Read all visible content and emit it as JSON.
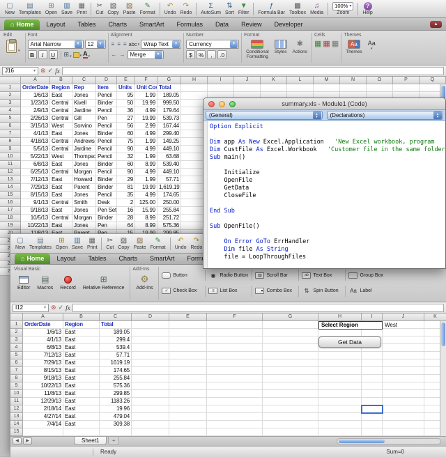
{
  "misc": {
    "fx": "fx"
  },
  "colors": {
    "accent_green": "#5a9732",
    "selection_blue": "#3b6fd4",
    "header_text_blue": "#2230c0",
    "vba_keyword_blue": "#0018c8",
    "vba_comment_green": "#0a7a0a",
    "record_red": "#c81e14",
    "aqua_scrollbar": "#6694d8"
  },
  "toolbar": {
    "groups": [
      [
        {
          "name": "new",
          "label": "New",
          "glyph": "▢",
          "color": "#5a7a9a"
        },
        {
          "name": "templates",
          "label": "Templates",
          "glyph": "▤",
          "color": "#5a7a9a"
        },
        {
          "name": "open",
          "label": "Open",
          "glyph": "⊞",
          "color": "#9a7b3c"
        },
        {
          "name": "save",
          "label": "Save",
          "glyph": "▥",
          "color": "#3c6a9a"
        },
        {
          "name": "print",
          "label": "Print",
          "glyph": "▦",
          "color": "#666666"
        }
      ],
      [
        {
          "name": "cut",
          "label": "Cut",
          "glyph": "✂",
          "color": "#555555"
        },
        {
          "name": "copy",
          "label": "Copy",
          "glyph": "▧",
          "color": "#555555"
        },
        {
          "name": "paste",
          "label": "Paste",
          "glyph": "▨",
          "color": "#8a6a3c"
        },
        {
          "name": "format",
          "label": "Format",
          "glyph": "✎",
          "color": "#3c8a3c"
        }
      ],
      [
        {
          "name": "undo",
          "label": "Undo",
          "glyph": "↶",
          "color": "#b8860b"
        },
        {
          "name": "redo",
          "label": "Redo",
          "glyph": "↷",
          "color": "#b8860b"
        }
      ],
      [
        {
          "name": "autosum",
          "label": "AutoSum",
          "glyph": "Σ",
          "color": "#2f5f8f"
        },
        {
          "name": "sort",
          "label": "Sort",
          "glyph": "⇅",
          "color": "#2f5f8f"
        },
        {
          "name": "filter",
          "label": "Filter",
          "glyph": "▼",
          "color": "#3c8a3c"
        }
      ],
      [
        {
          "name": "formula-bar",
          "label": "Formula Bar",
          "glyph": "ƒ",
          "color": "#2f5f8f"
        },
        {
          "name": "toolbox",
          "label": "Toolbox",
          "glyph": "▩",
          "color": "#555555"
        },
        {
          "name": "media",
          "label": "Media",
          "glyph": "♫",
          "color": "#7a3c8a"
        }
      ]
    ],
    "zoom": {
      "label": "Zoom",
      "value": "100%"
    },
    "help": {
      "label": "Help",
      "glyph": "?"
    }
  },
  "ribbon_tabs": [
    {
      "label": "Home",
      "active": true
    },
    {
      "label": "Layout"
    },
    {
      "label": "Tables"
    },
    {
      "label": "Charts"
    },
    {
      "label": "SmartArt"
    },
    {
      "label": "Formulas"
    },
    {
      "label": "Data"
    },
    {
      "label": "Review"
    },
    {
      "label": "Developer"
    }
  ],
  "ribbon1": {
    "group_edit": "Edit",
    "group_font": "Font",
    "group_alignment": "Alignment",
    "group_number": "Number",
    "group_format": "Format",
    "group_cells": "Cells",
    "group_themes": "Themes",
    "font_name": "Arial Narrow",
    "font_size": "12",
    "bold": "B",
    "italic": "I",
    "underline": "U",
    "abc": "abc",
    "wrap_text": "Wrap Text",
    "merge": "Merge",
    "number_format": "Currency",
    "cond_line1": "Conditional",
    "cond_line2": "Formatting",
    "styles": "Styles",
    "actions": "Actions",
    "themes_label": "Themes",
    "fonts_aa": "Aa"
  },
  "ribbon2": {
    "group_visual_basic": "Visual Basic",
    "group_addins": "Add-Ins",
    "items": [
      {
        "name": "editor",
        "label": "Editor"
      },
      {
        "name": "macros",
        "label": "Macros"
      },
      {
        "name": "record",
        "label": "Record"
      },
      {
        "name": "relative-reference",
        "label": "Relative Reference"
      }
    ],
    "addins_label": "Add-Ins",
    "form_controls": {
      "row1": [
        {
          "name": "button",
          "label": "Button"
        },
        {
          "name": "radio-button",
          "label": "Radio Button"
        },
        {
          "name": "scroll-bar",
          "label": "Scroll Bar"
        },
        {
          "name": "text-box",
          "label": "Text Box"
        },
        {
          "name": "group-box",
          "label": "Group Box"
        }
      ],
      "row2": [
        {
          "name": "check-box",
          "label": "Check Box"
        },
        {
          "name": "list-box",
          "label": "List Box"
        },
        {
          "name": "combo-box",
          "label": "Combo Box"
        },
        {
          "name": "spin-button",
          "label": "Spin Button"
        },
        {
          "name": "label",
          "label": "Label"
        }
      ]
    }
  },
  "sheet1": {
    "name_box": "J16",
    "col_letters": [
      "A",
      "B",
      "C",
      "D",
      "E",
      "F",
      "G",
      "H",
      "I",
      "J",
      "K",
      "L",
      "M",
      "N",
      "O",
      "P",
      "Q"
    ],
    "header_row": [
      "OrderDate",
      "Region",
      "Rep",
      "Item",
      "Units",
      "Unit Cost",
      "Total"
    ],
    "rows": [
      [
        "1/6/13",
        "East",
        "Jones",
        "Pencil",
        "95",
        "1.99",
        "189.05"
      ],
      [
        "1/23/13",
        "Central",
        "Kivell",
        "Binder",
        "50",
        "19.99",
        "999.50"
      ],
      [
        "2/9/13",
        "Central",
        "Jardine",
        "Pencil",
        "36",
        "4.99",
        "179.64"
      ],
      [
        "2/26/13",
        "Central",
        "Gill",
        "Pen",
        "27",
        "19.99",
        "539.73"
      ],
      [
        "3/15/13",
        "West",
        "Sorvino",
        "Pencil",
        "56",
        "2.99",
        "167.44"
      ],
      [
        "4/1/13",
        "East",
        "Jones",
        "Binder",
        "60",
        "4.99",
        "299.40"
      ],
      [
        "4/18/13",
        "Central",
        "Andrews",
        "Pencil",
        "75",
        "1.99",
        "149.25"
      ],
      [
        "5/5/13",
        "Central",
        "Jardine",
        "Pencil",
        "90",
        "4.99",
        "449.10"
      ],
      [
        "5/22/13",
        "West",
        "Thompson",
        "Pencil",
        "32",
        "1.99",
        "63.68"
      ],
      [
        "6/8/13",
        "East",
        "Jones",
        "Binder",
        "60",
        "8.99",
        "539.40"
      ],
      [
        "6/25/13",
        "Central",
        "Morgan",
        "Pencil",
        "90",
        "4.99",
        "449.10"
      ],
      [
        "7/12/13",
        "East",
        "Howard",
        "Binder",
        "29",
        "1.99",
        "57.71"
      ],
      [
        "7/29/13",
        "East",
        "Parent",
        "Binder",
        "81",
        "19.99",
        "1,619.19"
      ],
      [
        "8/15/13",
        "East",
        "Jones",
        "Pencil",
        "35",
        "4.99",
        "174.65"
      ],
      [
        "9/1/13",
        "Central",
        "Smith",
        "Desk",
        "2",
        "125.00",
        "250.00"
      ],
      [
        "9/18/13",
        "East",
        "Jones",
        "Pen Set",
        "16",
        "15.99",
        "255.84"
      ],
      [
        "10/5/13",
        "Central",
        "Morgan",
        "Binder",
        "28",
        "8.99",
        "251.72"
      ],
      [
        "10/22/13",
        "East",
        "Jones",
        "Pen",
        "64",
        "8.99",
        "575.36"
      ],
      [
        "11/8/13",
        "East",
        "Parent",
        "Pen",
        "15",
        "19.99",
        "299.85"
      ]
    ]
  },
  "sheet2": {
    "name_box": "I12",
    "col_letters": [
      "A",
      "B",
      "C",
      "D",
      "E",
      "F",
      "G",
      "H",
      "I",
      "J",
      "K"
    ],
    "header_row": [
      "OrderDate",
      "Region",
      "Total"
    ],
    "rows": [
      [
        "1/6/13",
        "East",
        "189.05"
      ],
      [
        "4/1/13",
        "East",
        "299.4"
      ],
      [
        "6/8/13",
        "East",
        "539.4"
      ],
      [
        "7/12/13",
        "East",
        "57.71"
      ],
      [
        "7/29/13",
        "East",
        "1619.19"
      ],
      [
        "8/15/13",
        "East",
        "174.65"
      ],
      [
        "9/18/13",
        "East",
        "255.84"
      ],
      [
        "10/22/13",
        "East",
        "575.36"
      ],
      [
        "11/8/13",
        "East",
        "299.85"
      ],
      [
        "12/29/13",
        "East",
        "1183.26"
      ],
      [
        "2/18/14",
        "East",
        "19.96"
      ],
      [
        "4/27/14",
        "East",
        "479.04"
      ],
      [
        "7/4/14",
        "East",
        "309.38"
      ]
    ],
    "select_region_label": "Select Region",
    "region_value": "West",
    "get_data_button": "Get Data",
    "sheet_tab": "Sheet1",
    "new_sheet_tab": "+",
    "status_ready": "Ready",
    "status_sum": "Sum=0"
  },
  "vba": {
    "window_title": "summary.xls - Module1 (Code)",
    "left_dropdown": "(General)",
    "right_dropdown": "(Declarations)",
    "code_lines": [
      [
        [
          "Option Explicit",
          "k"
        ]
      ],
      [],
      [
        [
          "Dim",
          "k"
        ],
        [
          " app ",
          "n"
        ],
        [
          "As",
          "k"
        ],
        [
          " ",
          "n"
        ],
        [
          "New",
          "k"
        ],
        [
          " Excel.Application   ",
          "n"
        ],
        [
          "'New Excel workbook, program",
          "c"
        ]
      ],
      [
        [
          "Dim",
          "k"
        ],
        [
          " CustFile ",
          "n"
        ],
        [
          "As",
          "k"
        ],
        [
          " Excel.Workbook   ",
          "n"
        ],
        [
          "'Customer file in the same folder",
          "c"
        ]
      ],
      [
        [
          "Sub",
          "k"
        ],
        [
          " main()",
          "n"
        ]
      ],
      [],
      [
        [
          "    Initialize",
          "n"
        ]
      ],
      [
        [
          "    OpenFile",
          "n"
        ]
      ],
      [
        [
          "    GetData",
          "n"
        ]
      ],
      [
        [
          "    CloseFile",
          "n"
        ]
      ],
      [],
      [
        [
          "End Sub",
          "k"
        ]
      ],
      [],
      [
        [
          "Sub",
          "k"
        ],
        [
          " OpenFile()",
          "n"
        ]
      ],
      [],
      [
        [
          "    ",
          "n"
        ],
        [
          "On Error GoTo",
          "k"
        ],
        [
          " ErrHandler",
          "n"
        ]
      ],
      [
        [
          "    ",
          "n"
        ],
        [
          "Dim",
          "k"
        ],
        [
          " file ",
          "n"
        ],
        [
          "As",
          "k"
        ],
        [
          " ",
          "n"
        ],
        [
          "String",
          "k"
        ]
      ],
      [
        [
          "    file = LoopThroughFiles",
          "n"
        ]
      ]
    ]
  }
}
